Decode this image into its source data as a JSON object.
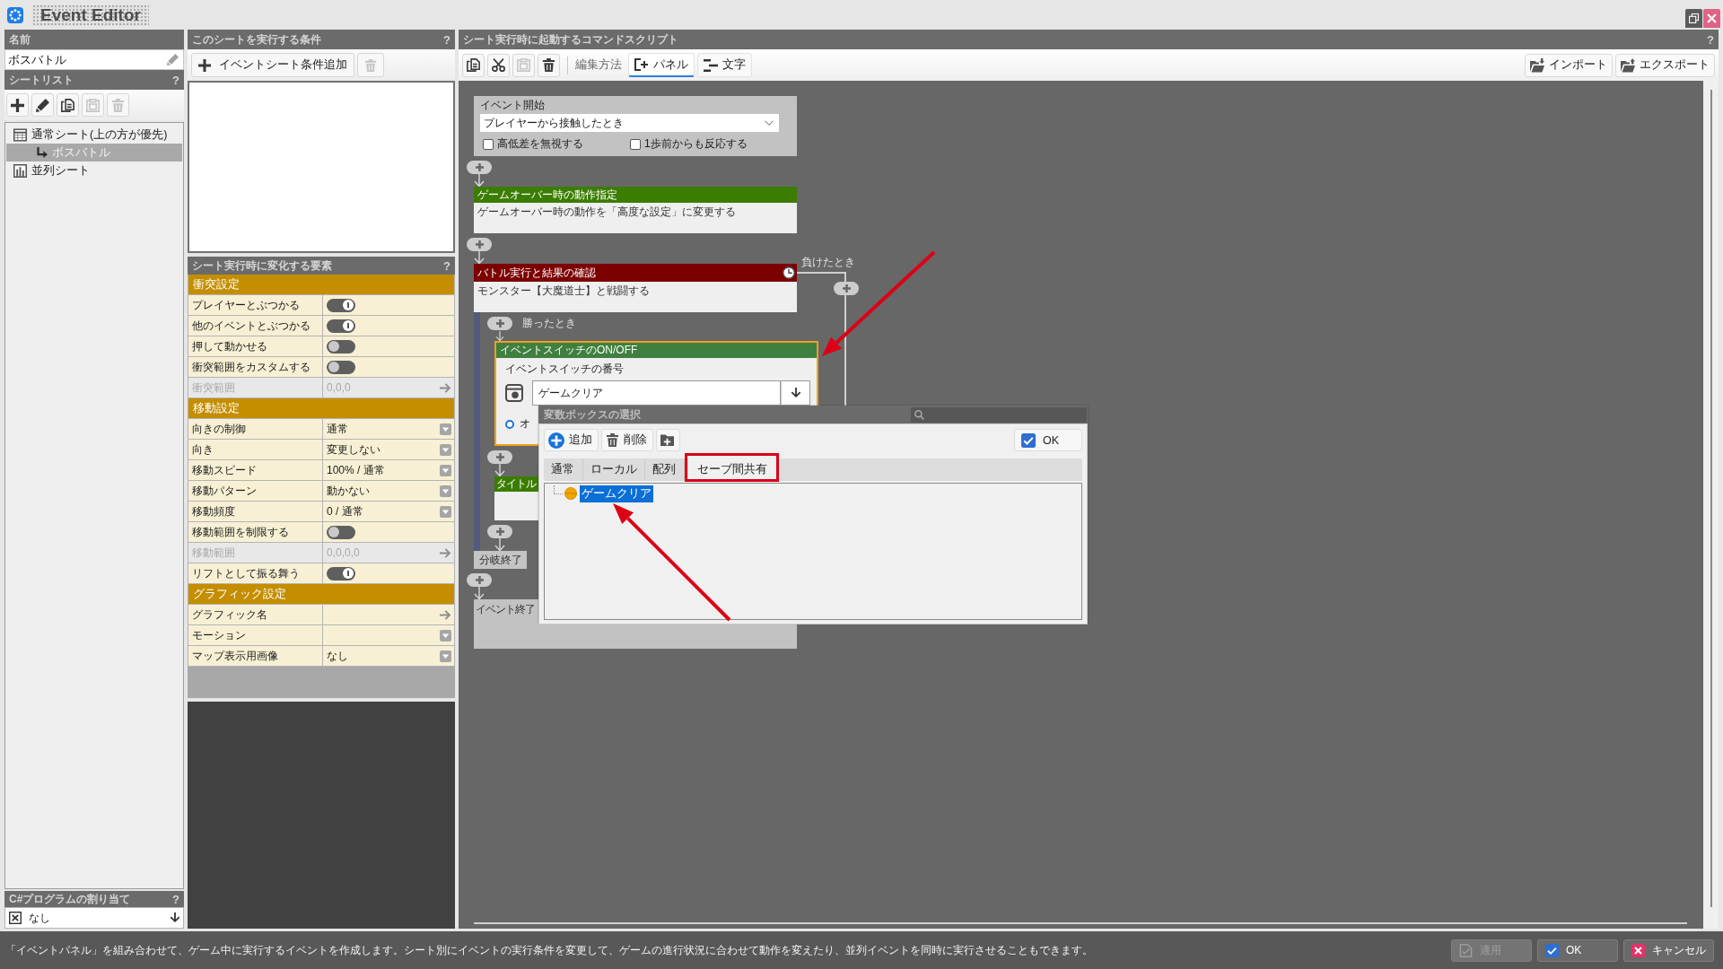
{
  "window": {
    "title": "Event Editor"
  },
  "name_panel": {
    "title": "名前",
    "value": "ボスバトル"
  },
  "sheet_list": {
    "title": "シートリスト",
    "help": "?",
    "tools": [
      {
        "kind": "add",
        "disabled": false
      },
      {
        "kind": "edit",
        "disabled": false
      },
      {
        "kind": "copy",
        "disabled": false
      },
      {
        "kind": "paste",
        "disabled": true
      },
      {
        "kind": "delete",
        "disabled": true
      }
    ],
    "tree": [
      {
        "label": "通常シート(上の方が優先)",
        "kind": "normal",
        "selected": false,
        "children": [
          {
            "label": "ボスバトル",
            "kind": "sheet",
            "selected": true
          }
        ]
      },
      {
        "label": "並列シート",
        "kind": "parallel",
        "selected": false
      }
    ]
  },
  "csharp_panel": {
    "title": "C#プログラムの割り当て",
    "help": "?",
    "value": "なし"
  },
  "conditions_panel": {
    "title": "このシートを実行する条件",
    "help": "?",
    "buttons": [
      {
        "kind": "add",
        "label": "イベントシート条件追加",
        "disabled": false
      },
      {
        "kind": "delete",
        "disabled": true
      }
    ]
  },
  "properties_panel": {
    "title": "シート実行時に変化する要素",
    "help": "?",
    "sections": [
      {
        "title": "衝突設定",
        "rows": [
          {
            "label": "プレイヤーとぶつかる",
            "kind": "toggle",
            "on": true,
            "disabled": false
          },
          {
            "label": "他のイベントとぶつかる",
            "kind": "toggle",
            "on": true,
            "disabled": false
          },
          {
            "label": "押して動かせる",
            "kind": "toggle",
            "on": false,
            "disabled": false
          },
          {
            "label": "衝突範囲をカスタムする",
            "kind": "toggle",
            "on": false,
            "disabled": false
          },
          {
            "label": "衝突範囲",
            "kind": "link",
            "value": "0,0,0",
            "disabled": true
          }
        ]
      },
      {
        "title": "移動設定",
        "rows": [
          {
            "label": "向きの制御",
            "kind": "select",
            "value": "通常",
            "disabled": false
          },
          {
            "label": "向き",
            "kind": "select",
            "value": "変更しない",
            "disabled": false
          },
          {
            "label": "移動スピード",
            "kind": "select",
            "value": "100% / 通常",
            "disabled": false
          },
          {
            "label": "移動パターン",
            "kind": "select",
            "value": "動かない",
            "disabled": false
          },
          {
            "label": "移動頻度",
            "kind": "select",
            "value": "0 / 通常",
            "disabled": false
          },
          {
            "label": "移動範囲を制限する",
            "kind": "toggle",
            "on": false,
            "disabled": false
          },
          {
            "label": "移動範囲",
            "kind": "link",
            "value": "0,0,0,0",
            "disabled": true
          },
          {
            "label": "リフトとして振る舞う",
            "kind": "toggle",
            "on": true,
            "disabled": false
          }
        ]
      },
      {
        "title": "グラフィック設定",
        "rows": [
          {
            "label": "グラフィック名",
            "kind": "link",
            "disabled": false
          },
          {
            "label": "モーション",
            "kind": "select",
            "disabled": false
          },
          {
            "label": "マップ表示用画像",
            "kind": "select",
            "value": "なし",
            "disabled": false
          }
        ]
      }
    ]
  },
  "script_panel": {
    "title": "シート実行時に起動するコマンドスクリプト",
    "help": "?",
    "tools": [
      {
        "kind": "copy",
        "disabled": false
      },
      {
        "kind": "cut",
        "disabled": false
      },
      {
        "kind": "paste",
        "disabled": true
      },
      {
        "kind": "delete",
        "disabled": false
      }
    ],
    "edit_mode_label": "編集方法",
    "modes": [
      {
        "kind": "panel",
        "label": "パネル",
        "selected": true
      },
      {
        "kind": "text",
        "label": "文字",
        "selected": false
      }
    ],
    "file_buttons": [
      {
        "kind": "import",
        "label": "インポート"
      },
      {
        "kind": "export",
        "label": "エクスポート"
      }
    ],
    "blocks": [
      {
        "kind": "start",
        "title": "イベント開始",
        "trigger": "プレイヤーから接触したとき",
        "options": [
          {
            "label": "高低差を無視する",
            "checked": false
          },
          {
            "label": "1歩前からも反応する",
            "checked": false
          }
        ]
      },
      {
        "kind": "command",
        "title": "ゲームオーバー時の動作指定",
        "color": "#3a7d00",
        "text": "ゲームオーバー時の動作を「高度な設定」に変更する"
      },
      {
        "kind": "branch",
        "title": "バトル実行と結果の確認",
        "color": "#7d0000",
        "text": "モンスター【大魔道士】と戦闘する",
        "timer": true,
        "branches": [
          {
            "label": "勝ったとき",
            "blocks": [
              {
                "kind": "switch",
                "title": "イベントスイッチのON/OFF",
                "color": "#3f7f3f",
                "focused": true,
                "field_label": "イベントスイッチの番号",
                "value": "ゲームクリア",
                "choice": {
                  "label": "オ",
                  "selected": true
                }
              },
              {
                "kind": "command",
                "title": "タイトル",
                "color": "#3a7d00"
              }
            ]
          },
          {
            "label": "負けたとき"
          }
        ],
        "end_label": "分岐終了"
      },
      {
        "kind": "end",
        "title": "イベント終了"
      }
    ]
  },
  "variable_dialog": {
    "title": "変数ボックスの選択",
    "tools": [
      {
        "kind": "add",
        "label": "追加"
      },
      {
        "kind": "delete",
        "label": "削除"
      },
      {
        "kind": "add_folder"
      }
    ],
    "ok_button": "OK",
    "tabs": [
      {
        "label": "通常",
        "selected": false,
        "annotated": false
      },
      {
        "label": "ローカル",
        "selected": false,
        "annotated": false
      },
      {
        "label": "配列",
        "selected": false,
        "annotated": false
      },
      {
        "label": "セーブ間共有",
        "selected": true,
        "annotated": true
      }
    ],
    "items": [
      {
        "label": "ゲームクリア",
        "selected": true
      }
    ]
  },
  "status_bar": {
    "message": "「イベントパネル」を組み合わせて、ゲーム中に実行するイベントを作成します。シート別にイベントの実行条件を変更して、ゲームの進行状況に合わせて動作を変えたり、並列イベントを同時に実行させることもできます。",
    "buttons": [
      {
        "kind": "apply",
        "label": "適用",
        "disabled": true
      },
      {
        "kind": "ok",
        "label": "OK",
        "disabled": false
      },
      {
        "kind": "cancel",
        "label": "キャンセル",
        "disabled": false
      }
    ]
  }
}
